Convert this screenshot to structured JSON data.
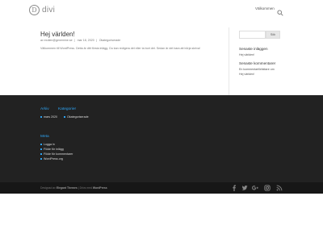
{
  "header": {
    "logo_mark": "D",
    "logo_text": "divi",
    "nav": [
      {
        "label": "Välkommen"
      }
    ]
  },
  "post": {
    "title": "Hej världen!",
    "meta": {
      "author": "av exdien@genemine.se",
      "date": "mar 18, 2020",
      "category": "Okategoriserade"
    },
    "excerpt": "Välkommen till WordPress. Detta är ditt första inlägg. Du kan redigera det eller ta bort det. Sedan är det bara att börja skriva!"
  },
  "sidebar": {
    "search_placeholder": "",
    "search_button": "Sök",
    "recent_posts_title": "Senaste inläggen",
    "recent_posts": [
      "Hej världen!"
    ],
    "recent_comments_title": "Senaste kommentarer",
    "recent_comments": [
      "En kommentarförfattare om",
      "Hej världen!"
    ]
  },
  "footer": {
    "archive_title": "Arkiv",
    "archive_items": [
      "mars 2020"
    ],
    "categories_title": "Kategorier",
    "categories_items": [
      "Okategoriserade"
    ],
    "meta_title": "Meta",
    "meta_items": [
      "Logga in",
      "Flöde för inlägg",
      "Flöde för kommentarer",
      "WordPress.org"
    ]
  },
  "bottom_bar": {
    "designed_by": "Designad av",
    "elegant": "Elegant Themes",
    "powered_by": "Drivs med",
    "wordpress": "WordPress"
  },
  "social_icons": [
    "facebook-icon",
    "twitter-icon",
    "google-plus-icon",
    "instagram-icon",
    "rss-icon"
  ],
  "colors": {
    "accent": "#2ea3f2",
    "footer_bg": "#222222",
    "bottom_bar_bg": "#171717"
  }
}
